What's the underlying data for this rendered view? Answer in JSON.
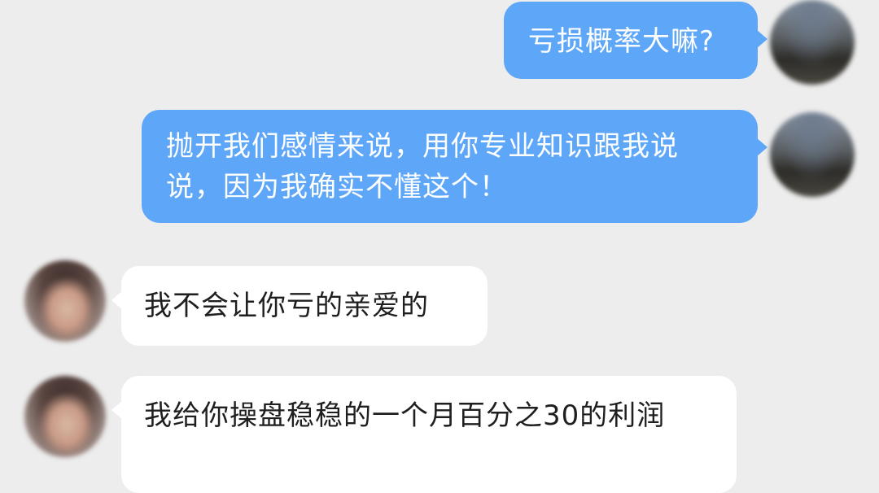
{
  "messages": [
    {
      "sender": "self",
      "text": "亏损概率大嘛?"
    },
    {
      "sender": "self",
      "text": "抛开我们感情来说，用你专业知识跟我说说，因为我确实不懂这个！"
    },
    {
      "sender": "other",
      "text": "我不会让你亏的亲爱的"
    },
    {
      "sender": "other",
      "text": "我给你操盘稳稳的一个月百分之30的利润"
    }
  ],
  "colors": {
    "background": "#ededed",
    "self_bubble": "#5ea7f8",
    "other_bubble": "#ffffff",
    "self_text": "#ffffff",
    "other_text": "#1f1f1f"
  }
}
